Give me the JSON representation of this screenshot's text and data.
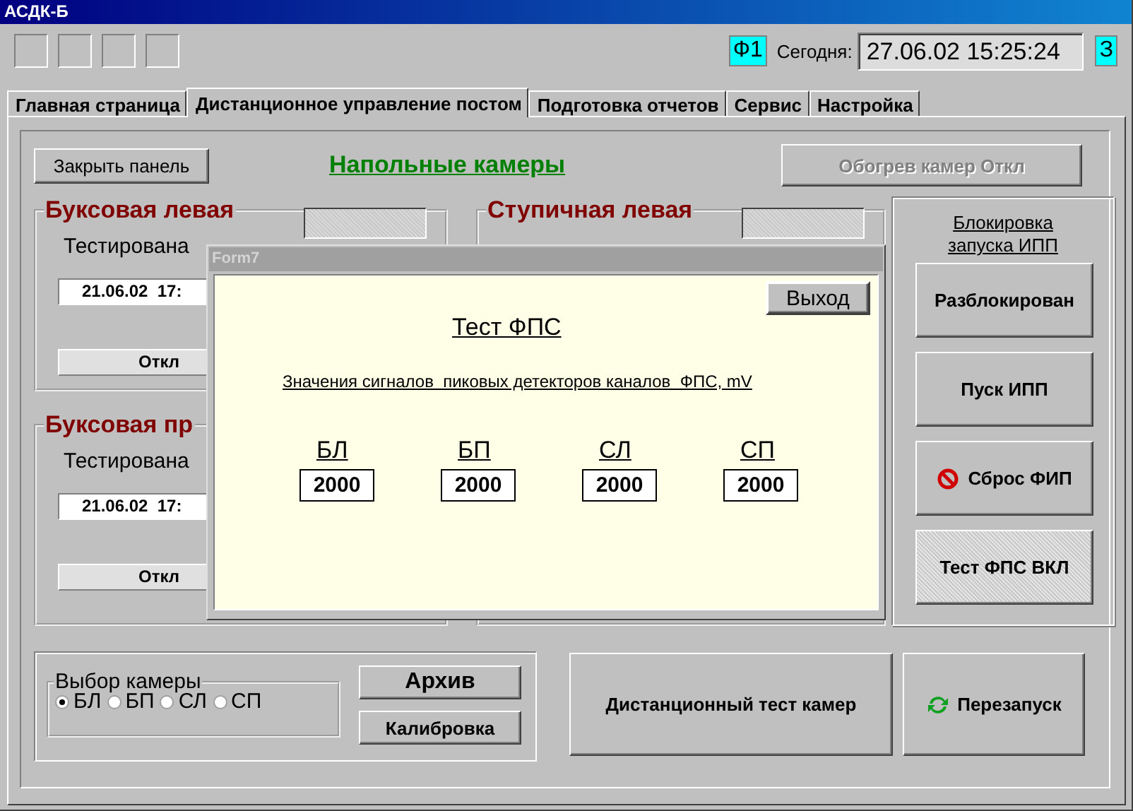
{
  "window": {
    "title": "АСДК-Б"
  },
  "toolbar": {
    "blank_buttons": [
      {
        "kind": "blank"
      },
      {
        "kind": "blank"
      },
      {
        "kind": "blank"
      },
      {
        "kind": "blank"
      }
    ],
    "f1_badge": "Ф1",
    "today_label": "Сегодня:",
    "datetime": "27.06.02 15:25:24",
    "z_badge": "З"
  },
  "tabs": [
    {
      "label": "Главная страница",
      "selected": false
    },
    {
      "label": "Дистанционное управление постом",
      "selected": true
    },
    {
      "label": "Подготовка отчетов",
      "selected": false
    },
    {
      "label": "Сервис",
      "selected": false
    },
    {
      "label": "Настройка",
      "selected": false
    }
  ],
  "panel": {
    "close_button": "Закрыть панель",
    "title": "Напольные камеры",
    "heating_button": {
      "label": "Обогрев  камер  Откл",
      "disabled": true
    }
  },
  "camera_groups": [
    {
      "title": "Буксовая левая",
      "tested_label": "Тестирована",
      "date": "21.06.02  17:",
      "status": "Откл",
      "indicator": true
    },
    {
      "title": "Буксовая пр",
      "tested_label": "Тестирована",
      "date": "21.06.02  17:",
      "status": "Откл",
      "indicator": false
    },
    {
      "title": "Ступичная левая",
      "indicator": true
    },
    {
      "indicator": false
    }
  ],
  "lock_panel": {
    "link": "Блокировка запуска ИПП",
    "buttons": [
      {
        "label": "Разблокирован",
        "kind": "plain"
      },
      {
        "label": "Пуск ИПП",
        "kind": "plain"
      },
      {
        "label": "Сброс ФИП",
        "kind": "stop"
      },
      {
        "label": "Тест ФПС ВКЛ",
        "kind": "pressed"
      }
    ]
  },
  "camera_select": {
    "title": "Выбор камеры",
    "options": [
      {
        "label": "БЛ",
        "selected": true
      },
      {
        "label": "БП",
        "selected": false
      },
      {
        "label": "СЛ",
        "selected": false
      },
      {
        "label": "СП",
        "selected": false
      }
    ]
  },
  "archive_button": "Архив",
  "calibration_button": "Калибровка",
  "remote_test_button": "Дистанционный тест камер",
  "restart_button": "Перезапуск",
  "dialog": {
    "title": "Form7",
    "exit_button": "Выход",
    "heading": "Тест ФПС",
    "caption": "Значения сигналов  пиковых детекторов каналов  ФПС, mV",
    "channels": [
      {
        "name": "БЛ",
        "value": "2000"
      },
      {
        "name": "БП",
        "value": "2000"
      },
      {
        "name": "СЛ",
        "value": "2000"
      },
      {
        "name": "СП",
        "value": "2000"
      }
    ]
  }
}
